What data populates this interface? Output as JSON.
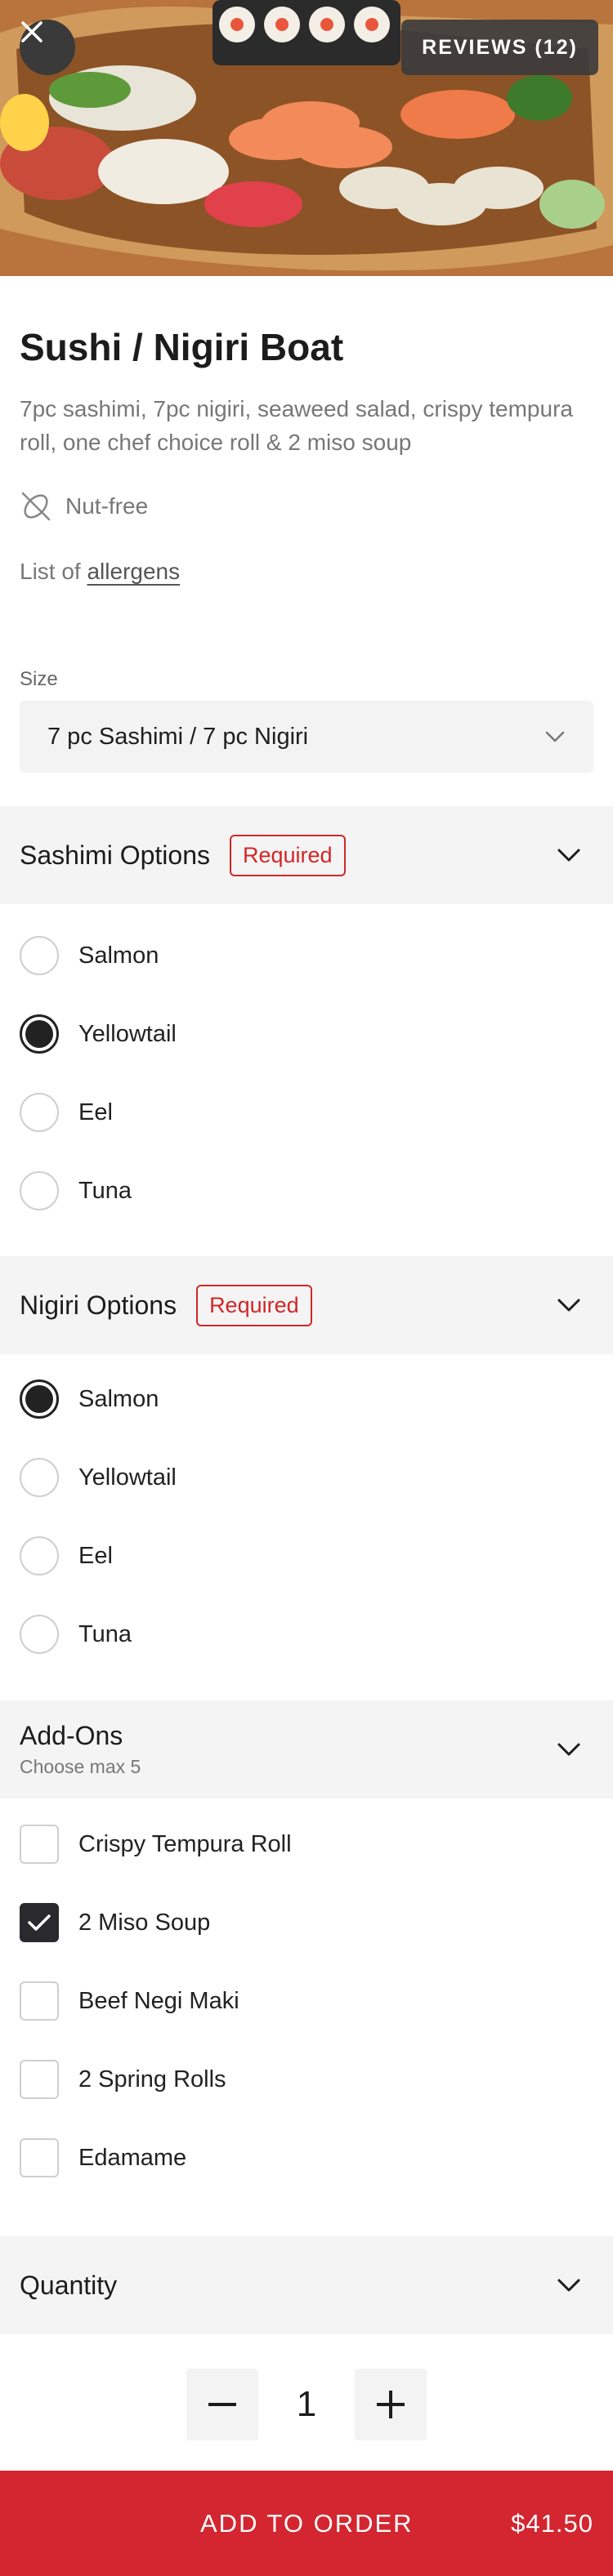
{
  "header": {
    "reviews_label": "REVIEWS (12)"
  },
  "item": {
    "title": "Sushi / Nigiri Boat",
    "description": "7pc sashimi, 7pc nigiri, seaweed salad, crispy tempura roll, one chef choice roll & 2 miso soup",
    "diet_tag": "Nut-free",
    "allergens_prefix": "List of",
    "allergens_link": "allergens"
  },
  "size": {
    "label": "Size",
    "value": "7 pc Sashimi / 7 pc Nigiri"
  },
  "sashimi": {
    "title": "Sashimi Options",
    "badge": "Required",
    "options": [
      {
        "label": "Salmon",
        "selected": false
      },
      {
        "label": "Yellowtail",
        "selected": true
      },
      {
        "label": "Eel",
        "selected": false
      },
      {
        "label": "Tuna",
        "selected": false
      }
    ]
  },
  "nigiri": {
    "title": "Nigiri Options",
    "badge": "Required",
    "options": [
      {
        "label": "Salmon",
        "selected": true
      },
      {
        "label": "Yellowtail",
        "selected": false
      },
      {
        "label": "Eel",
        "selected": false
      },
      {
        "label": "Tuna",
        "selected": false
      }
    ]
  },
  "addons": {
    "title": "Add-Ons",
    "subtitle": "Choose max 5",
    "options": [
      {
        "label": "Crispy Tempura Roll",
        "checked": false
      },
      {
        "label": "2 Miso Soup",
        "checked": true
      },
      {
        "label": "Beef Negi Maki",
        "checked": false
      },
      {
        "label": "2 Spring Rolls",
        "checked": false
      },
      {
        "label": "Edamame",
        "checked": false
      }
    ]
  },
  "quantity": {
    "title": "Quantity",
    "value": "1"
  },
  "order": {
    "button_label": "ADD TO ORDER",
    "price": "$41.50"
  },
  "colors": {
    "accent": "#d32630",
    "badge": "#d32626",
    "section_bg": "#f4f4f5"
  }
}
